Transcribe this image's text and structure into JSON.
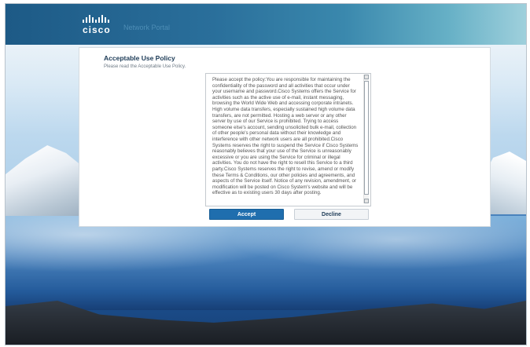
{
  "header": {
    "logo_text": "cisco",
    "product_name": "Network Portal"
  },
  "policy": {
    "title": "Acceptable Use Policy",
    "subtitle": "Please read the Acceptable Use Policy.",
    "text": "Please accept the policy:You are responsible for maintaining the confidentiality of the password and all activities that occur under your username and password.Cisco Systems offers the Service for activities such as the active use of e-mail, instant messaging, browsing the World Wide Web and accessing corporate intranets. High volume data transfers, especially sustained high volume data transfers, are not permitted. Hosting a web server or any other server by use of our Service is prohibited. Trying to access someone else's account, sending unsolicited bulk e-mail, collection of other people's personal data without their knowledge and interference with other network users are all prohibited.Cisco Systems reserves the right to suspend the Service if Cisco Systems reasonably believes that your use of the Service is unreasonably excessive or you are using the Service for criminal or illegal activities. You do not have the right to resell this Service to a third party.Cisco Systems reserves the right to revise, amend or modify these Terms & Conditions, our other policies and agreements, and aspects of the Service itself. Notice of any revision, amendment, or modification will be posted on Cisco System's website and will be effective as to existing users 30 days after posting."
  },
  "buttons": {
    "accept_label": "Accept",
    "decline_label": "Decline"
  },
  "colors": {
    "accent": "#1f6eae",
    "header": "#2a6f9b"
  }
}
